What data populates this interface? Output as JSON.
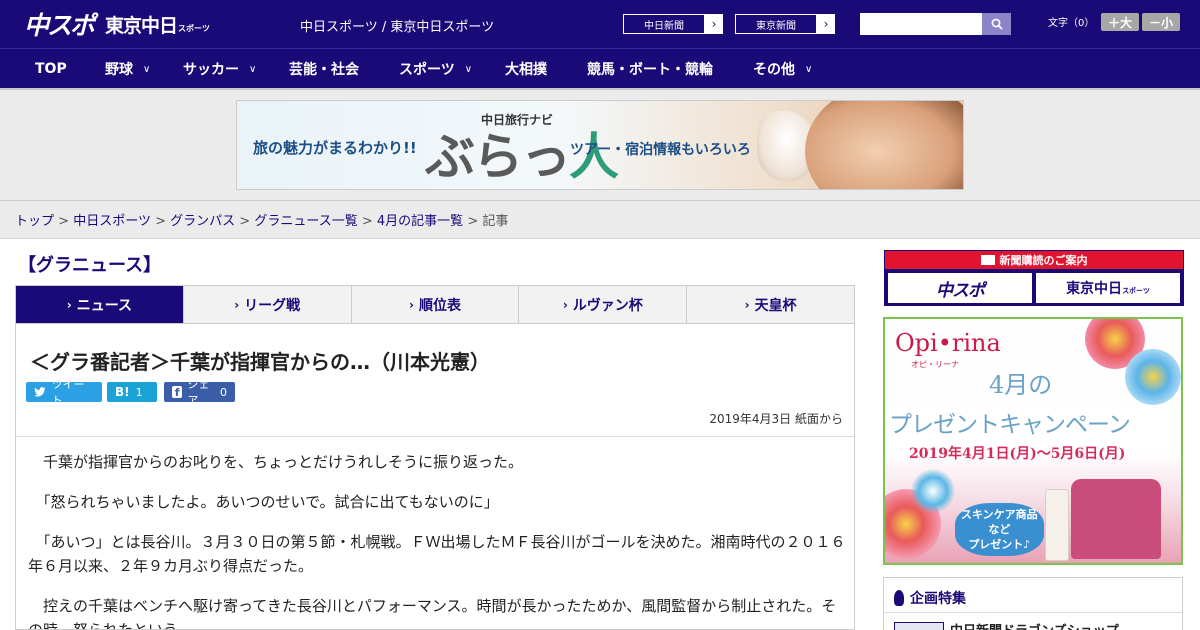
{
  "header": {
    "logo_main": "中スポ",
    "logo_tokyo": "東京中日",
    "logo_tokyo_small": "スポーツ",
    "site_name": "中日スポーツ / 東京中日スポーツ",
    "paper_links": [
      "中日新聞",
      "東京新聞"
    ],
    "font_size_label": "文字（0）",
    "font_larger": "＋大",
    "font_smaller": "－小"
  },
  "nav": {
    "items": [
      {
        "label": "TOP",
        "has_dropdown": false
      },
      {
        "label": "野球",
        "has_dropdown": true
      },
      {
        "label": "サッカー",
        "has_dropdown": true
      },
      {
        "label": "芸能・社会",
        "has_dropdown": false
      },
      {
        "label": "スポーツ",
        "has_dropdown": true
      },
      {
        "label": "大相撲",
        "has_dropdown": false
      },
      {
        "label": "競馬・ボート・競輪",
        "has_dropdown": false
      },
      {
        "label": "その他",
        "has_dropdown": true
      }
    ]
  },
  "banner": {
    "left_text": "旅の魅力がまるわかり!!",
    "subtitle": "中日旅行ナビ",
    "logo_text": "ぶらっ",
    "logo_accent": "人",
    "right_text": "ツアー・宿泊情報もいろいろ"
  },
  "breadcrumb": {
    "links": [
      "トップ",
      "中日スポーツ",
      "グランパス",
      "グラニュース一覧",
      "4月の記事一覧"
    ],
    "current": "記事",
    "separator": ">"
  },
  "section": {
    "title": "【グラニュース】"
  },
  "tabs": [
    {
      "label": "ニュース",
      "active": true
    },
    {
      "label": "リーグ戦",
      "active": false
    },
    {
      "label": "順位表",
      "active": false
    },
    {
      "label": "ルヴァン杯",
      "active": false
    },
    {
      "label": "天皇杯",
      "active": false
    }
  ],
  "article": {
    "headline": "＜グラ番記者＞千葉が指揮官からの…（川本光憲）",
    "share": {
      "tweet": "ツイート",
      "hatena_icon": "B!",
      "hatena_count": "1",
      "fb_label": "シェア",
      "fb_count": "0"
    },
    "date": "2019年4月3日 紙面から",
    "paragraphs": [
      "千葉が指揮官からのお叱りを、ちょっとだけうれしそうに振り返った。",
      "「怒られちゃいましたよ。あいつのせいで。試合に出てもないのに」",
      "「あいつ」とは長谷川。３月３０日の第５節・札幌戦。ＦＷ出場したＭＦ長谷川がゴールを決めた。湘南時代の２０１６年６月以来、２年９カ月ぶり得点だった。",
      "控えの千葉はベンチへ駆け寄ってきた長谷川とパフォーマンス。時間が長かったためか、風間監督から制止された。その時、怒られたという。"
    ]
  },
  "sidebar": {
    "subscribe_header": "新聞購読のご案内",
    "subscribe_logos": [
      "中スポ",
      "東京中日"
    ],
    "subscribe_logo_small": "スポーツ",
    "ad": {
      "brand": "Opi•rina",
      "brand_sub": "オピ・リーナ",
      "month": "4月の",
      "campaign": "プレゼントキャンペーン",
      "period": "2019年4月1日(月)～5月6日(月)",
      "gift_line1": "スキンケア商品",
      "gift_line2": "など",
      "gift_line3": "プレゼント♪"
    },
    "feature_title": "企画特集",
    "feature_item": "中日新聞ドラゴンズショップ"
  },
  "colors": {
    "brand_navy": "#1a0a78",
    "subscribe_red": "#e2132e",
    "twitter": "#2ba0e4",
    "hatena": "#1ba3d8",
    "facebook": "#3b5ea8"
  }
}
